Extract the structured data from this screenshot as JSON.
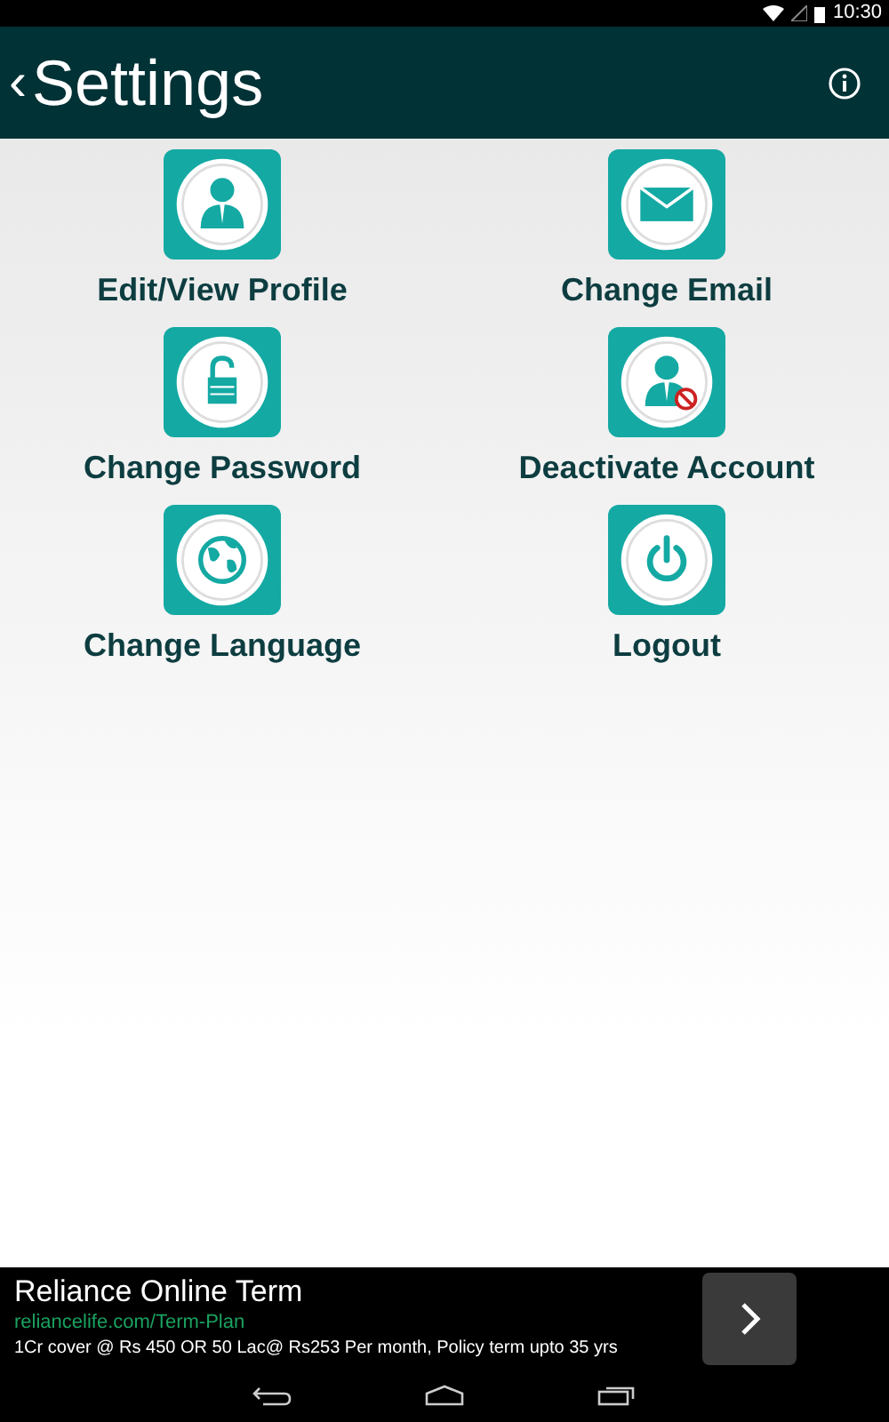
{
  "status_bar": {
    "time": "10:30"
  },
  "header": {
    "back": "‹",
    "title": "Settings"
  },
  "options": [
    {
      "label": "Edit/View Profile"
    },
    {
      "label": "Change Email"
    },
    {
      "label": "Change Password"
    },
    {
      "label": "Deactivate Account"
    },
    {
      "label": "Change Language"
    },
    {
      "label": "Logout"
    }
  ],
  "ad": {
    "title": "Reliance Online Term",
    "url": "reliancelife.com/Term-Plan",
    "text": "1Cr cover @ Rs 450 OR 50 Lac@ Rs253 Per month, Policy term upto 35 yrs"
  }
}
